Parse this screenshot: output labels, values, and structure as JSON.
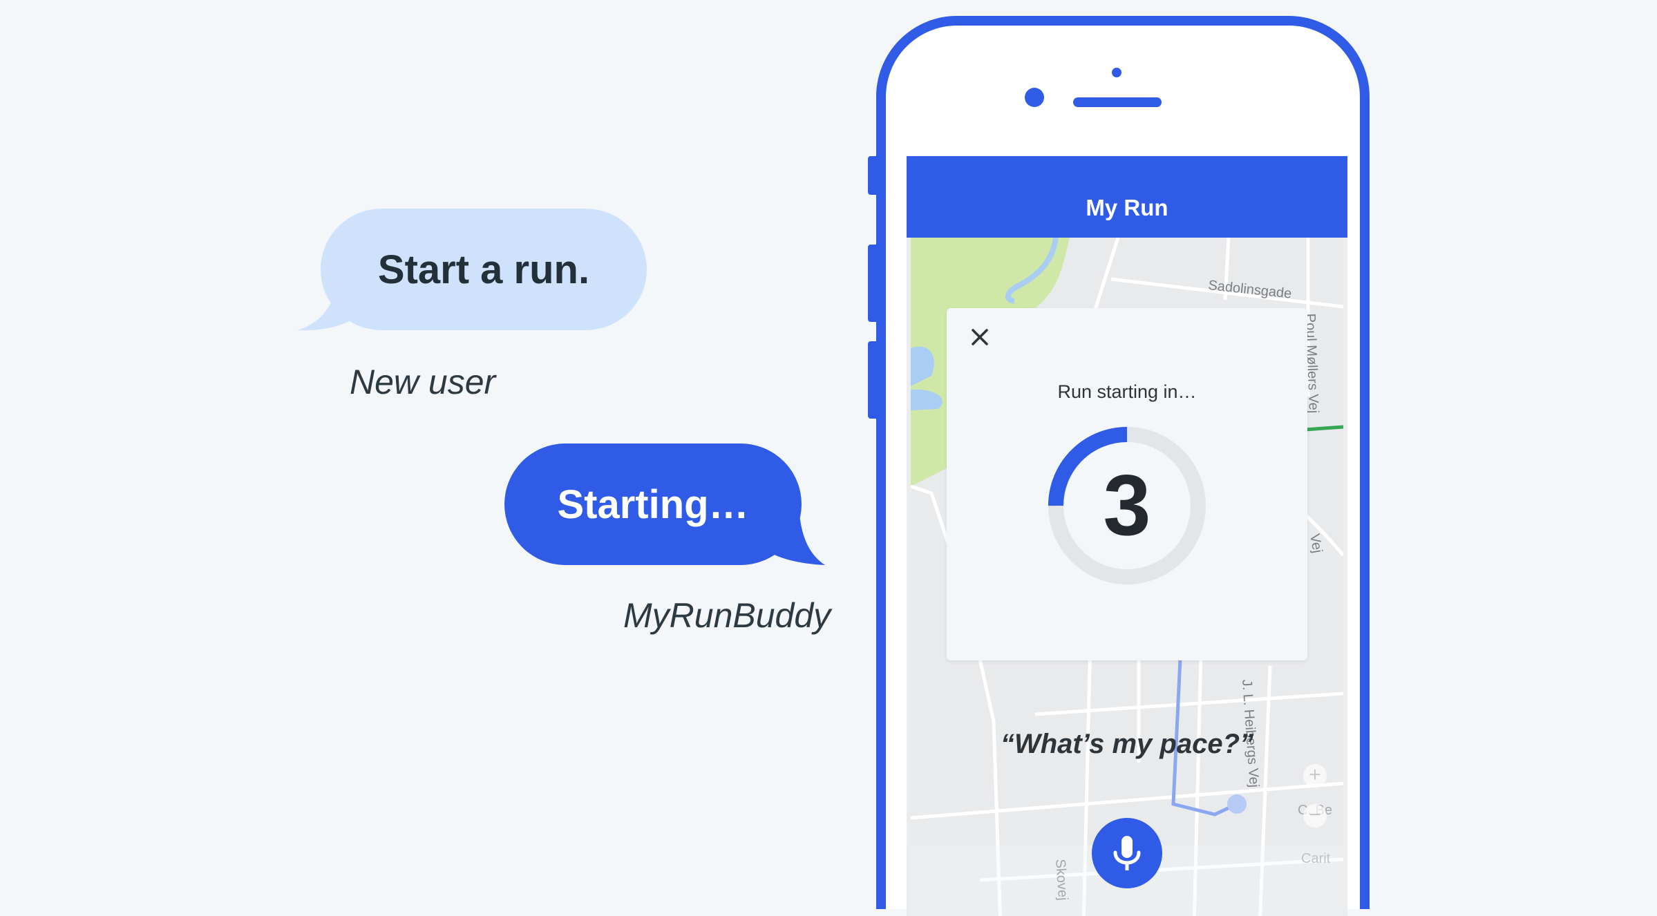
{
  "chat": {
    "user_message": "Start a run.",
    "user_name": "New user",
    "bot_message": "Starting…",
    "bot_name": "MyRunBuddy"
  },
  "app": {
    "title": "My Run"
  },
  "map": {
    "streets": [
      "Sadolinsgade",
      "Poul Møllers Vej",
      "J. L. Heibergs Vej",
      "Vej",
      "Skovej",
      "C. Be",
      "Carit"
    ],
    "colors": {
      "park": "#cfe8a8",
      "water": "#a9cdf3",
      "road": "#ffffff",
      "route": "#8aa7ef"
    }
  },
  "dialog": {
    "title": "Run starting in…",
    "countdown": "3",
    "countdown_progress_fraction": 0.25,
    "close_icon": "close-icon"
  },
  "voice": {
    "prompt": "“What’s my pace?”",
    "mic_icon": "mic-icon"
  },
  "colors": {
    "accent": "#2f5be7",
    "user_bubble": "#cfe2fc",
    "background": "#f4f7fa"
  }
}
